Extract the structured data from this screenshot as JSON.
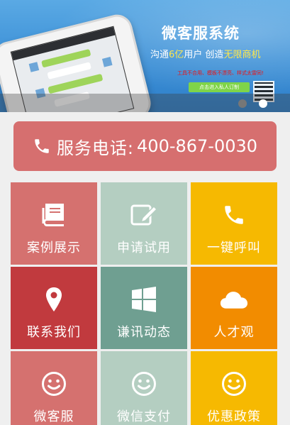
{
  "banner": {
    "title": "微客服系统",
    "subtitle_prefix": "沟通",
    "subtitle_hl1": "6亿",
    "subtitle_mid": "用户   创造",
    "subtitle_hl2": "无限商机",
    "small_text": "工具不合用、模板不漂亮、样式太雷同!",
    "button_label": "点击进入私人订制",
    "active_slide": 2,
    "slide_count": 2
  },
  "call": {
    "label": "服务电话:",
    "number": "400-867-0030"
  },
  "tiles": [
    {
      "label": "案例展示",
      "icon": "book-icon",
      "color": "#d5716f"
    },
    {
      "label": "申请试用",
      "icon": "edit-icon",
      "color": "#b4cec1"
    },
    {
      "label": "一键呼叫",
      "icon": "phone-icon",
      "color": "#f6b901"
    },
    {
      "label": "联系我们",
      "icon": "location-pin-icon",
      "color": "#c13a3e"
    },
    {
      "label": "谦讯动态",
      "icon": "windows-icon",
      "color": "#6f9f91"
    },
    {
      "label": "人才观",
      "icon": "cloud-icon",
      "color": "#f28c00"
    },
    {
      "label": "微客服",
      "icon": "smiley-icon",
      "color": "#d5716f"
    },
    {
      "label": "微信支付",
      "icon": "smiley-icon",
      "color": "#b4cec1"
    },
    {
      "label": "优惠政策",
      "icon": "smiley-icon",
      "color": "#f6b901"
    }
  ]
}
